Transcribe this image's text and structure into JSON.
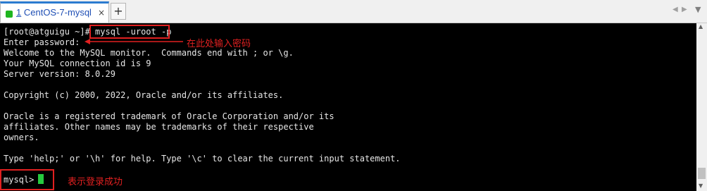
{
  "tab": {
    "number": "1",
    "title": "CentOS-7-mysql",
    "close": "×"
  },
  "tabbar": {
    "add": "+",
    "nav_left": "◀",
    "nav_right": "▶",
    "menu": "▼"
  },
  "terminal": {
    "lines": [
      "[root@atguigu ~]# mysql -uroot -p",
      "Enter password:",
      "Welcome to the MySQL monitor.  Commands end with ; or \\g.",
      "Your MySQL connection id is 9",
      "Server version: 8.0.29",
      "",
      "Copyright (c) 2000, 2022, Oracle and/or its affiliates.",
      "",
      "Oracle is a registered trademark of Oracle Corporation and/or its",
      "affiliates. Other names may be trademarks of their respective",
      "owners.",
      "",
      "Type 'help;' or '\\h' for help. Type '\\c' to clear the current input statement.",
      "",
      "mysql> "
    ]
  },
  "annotations": {
    "password_hint": "在此处输入密码",
    "login_success": "表示登录成功"
  },
  "colors": {
    "terminal_bg": "#000000",
    "terminal_text": "#e6e6e6",
    "cursor": "#27c93f",
    "annotation": "#e02020",
    "tab_accent": "#2b7bd0"
  }
}
